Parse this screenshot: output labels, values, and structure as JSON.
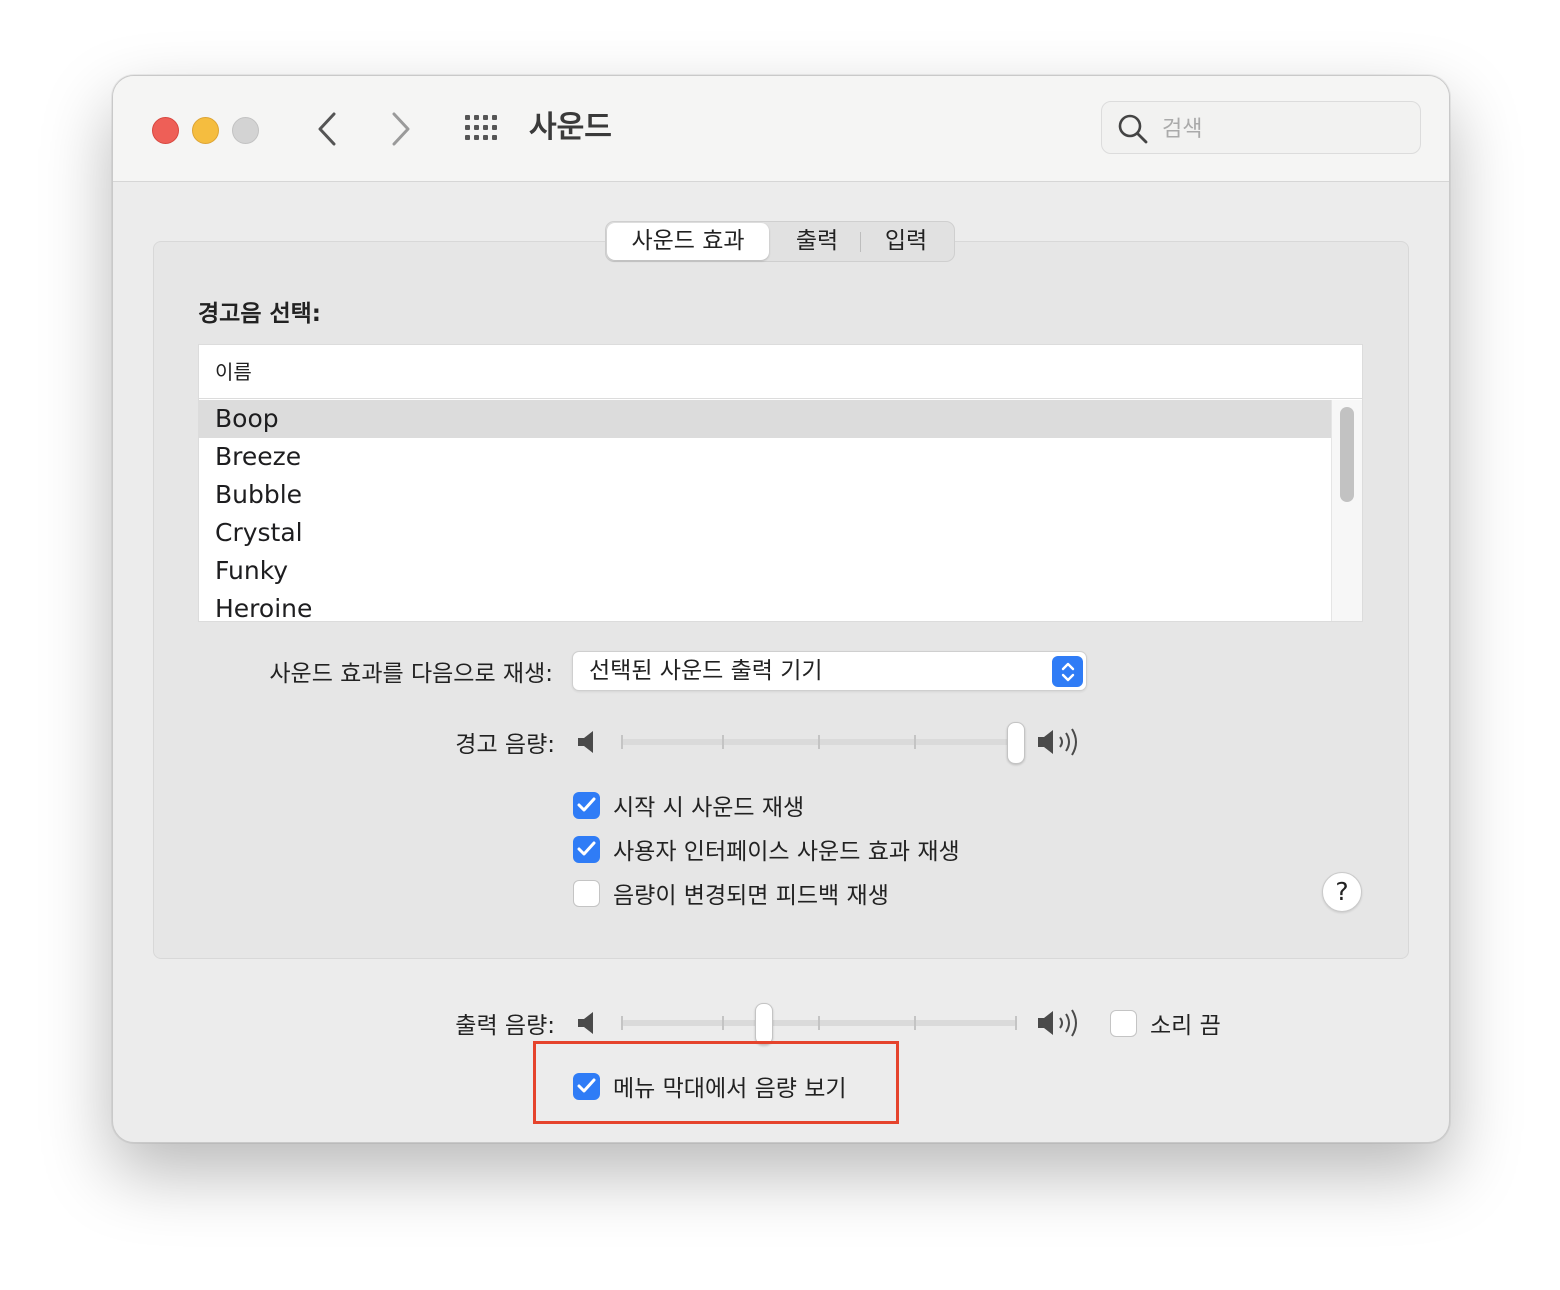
{
  "window": {
    "title": "사운드"
  },
  "search": {
    "placeholder": "검색"
  },
  "tabs": [
    {
      "label": "사운드 효과",
      "active": true
    },
    {
      "label": "출력",
      "active": false
    },
    {
      "label": "입력",
      "active": false
    }
  ],
  "alert_sound": {
    "section_label": "경고음 선택:",
    "column_header": "이름",
    "items": [
      "Boop",
      "Breeze",
      "Bubble",
      "Crystal",
      "Funky",
      "Heroine"
    ],
    "selected": "Boop"
  },
  "play_through": {
    "label": "사운드 효과를 다음으로 재생:",
    "value": "선택된 사운드 출력 기기"
  },
  "alert_volume": {
    "label": "경고 음량:",
    "level": 1.0
  },
  "checkboxes": [
    {
      "label": "시작 시 사운드 재생",
      "checked": true
    },
    {
      "label": "사용자 인터페이스 사운드 효과 재생",
      "checked": true
    },
    {
      "label": "음량이 변경되면 피드백 재생",
      "checked": false
    }
  ],
  "help": {
    "label": "?"
  },
  "output_volume": {
    "label": "출력 음량:",
    "level": 0.36
  },
  "mute": {
    "label": "소리 끔",
    "checked": false
  },
  "menu_bar_volume": {
    "label": "메뉴 막대에서 음량 보기",
    "checked": true
  },
  "colors": {
    "accent": "#2f7cf6",
    "highlight": "#e5432c",
    "close": "#ee5f57",
    "minimize": "#f5bd3f",
    "zoom": "#d3d3d3"
  }
}
